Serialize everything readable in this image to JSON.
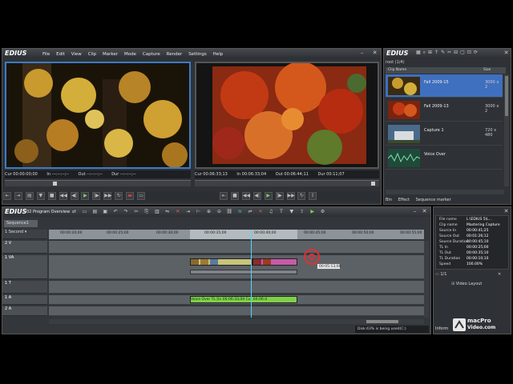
{
  "app": {
    "logo": "EDIUS",
    "menu": [
      "File",
      "Edit",
      "View",
      "Clip",
      "Marker",
      "Mode",
      "Capture",
      "Render",
      "Settings",
      "Help"
    ]
  },
  "player": {
    "cur": "Cur 00:00:00;00",
    "in": "In ---:--:--;--",
    "out": "Out --:--:--;--",
    "dur": "Dur --:--:--;--"
  },
  "recorder": {
    "cur": "Cur 00:06:33;13",
    "in": "In 00:06:33;04",
    "out": "Out 00:06:44;11",
    "dur": "Dur 00:11;07"
  },
  "bin": {
    "logo": "EDIUS",
    "folder": "root (1/4)",
    "col_name": "Clip Name",
    "col_size": "Size",
    "items": [
      {
        "name": "Fall 2009-15",
        "size": "3000 x 2"
      },
      {
        "name": "Fall 2009-13",
        "size": "3000 x 2"
      },
      {
        "name": "Capture 1",
        "size": "720 x 480"
      },
      {
        "name": "Voice Over",
        "size": ""
      }
    ],
    "tabs": [
      "Bin",
      "Effect",
      "Sequence marker"
    ],
    "accent": "#3f6fbf"
  },
  "timeline": {
    "logo": "EDIUS",
    "sequence_name": "02 Program Overview",
    "seq_tab": "Sequence1",
    "ticks": [
      "00:00:20;00",
      "00:00:25;00",
      "00:00:30;00",
      "00:00:35;00",
      "00:00:40;00",
      "00:00:45;00",
      "00:00:50;00",
      "00:00:55;00"
    ],
    "tracks": {
      "t2v": "2 V",
      "t1va": "1 VA",
      "t1t": "1 T",
      "t1a": "1 A",
      "t2a": "2 A"
    },
    "voice_clip": "Voice Over   TL [In 00:06:33;04 Cut 00:06:4",
    "tooltip": "00:05:13;00",
    "status": "Disk:43% is being used(C:)"
  },
  "info": {
    "rows": [
      {
        "k": "File name",
        "v": "L:\\EDIUS 5\\L..."
      },
      {
        "k": "Clip name",
        "v": "Mastering Capture"
      },
      {
        "k": "Source In",
        "v": "00:00:41;25"
      },
      {
        "k": "Source Out",
        "v": "00:01:26;12"
      },
      {
        "k": "Source Duration",
        "v": "00:00:45;10"
      },
      {
        "k": "TL In",
        "v": "00:00:25;00"
      },
      {
        "k": "TL Out",
        "v": "00:00:35;10"
      },
      {
        "k": "TL Duration",
        "v": "00:00:10;10"
      },
      {
        "k": "Speed",
        "v": "100.00%"
      }
    ],
    "page": "1/1",
    "video_layout": "Video Layout",
    "tab": "Inform"
  },
  "watermark": {
    "line1": "macPro",
    "line2": "Video.com"
  }
}
